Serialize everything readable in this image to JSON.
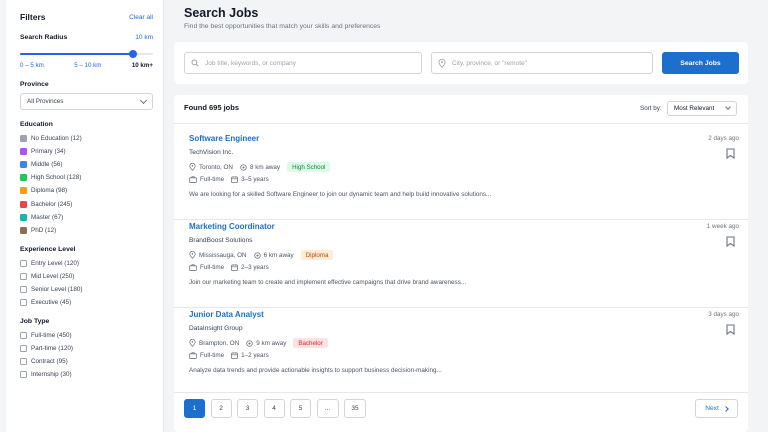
{
  "filters": {
    "title": "Filters",
    "clear_all": "Clear all",
    "radius": {
      "label": "Search Radius",
      "value_text": "10 km",
      "fraction": 0.85,
      "ticks": [
        "0 – 5 km",
        "5 – 10 km",
        "10 km+"
      ]
    },
    "province": {
      "label": "Province",
      "selected": "All Provinces"
    },
    "education": {
      "label": "Education",
      "items": [
        {
          "label": "No Education (12)",
          "color": "#9ca3af"
        },
        {
          "label": "Primary (34)",
          "color": "#a855f7"
        },
        {
          "label": "Middle (56)",
          "color": "#3b82f6"
        },
        {
          "label": "High School (128)",
          "color": "#22c55e"
        },
        {
          "label": "Diploma (98)",
          "color": "#f59e0b"
        },
        {
          "label": "Bachelor (245)",
          "color": "#ef4444"
        },
        {
          "label": "Master (67)",
          "color": "#14b8a6"
        },
        {
          "label": "PhD (12)",
          "color": "#8b6f5c"
        }
      ]
    },
    "experience": {
      "label": "Experience Level",
      "items": [
        "Entry Level (120)",
        "Mid Level (250)",
        "Senior Level (180)",
        "Executive (45)"
      ]
    },
    "job_type": {
      "label": "Job Type",
      "items": [
        "Full-time (450)",
        "Part-time (120)",
        "Contract (95)",
        "Internship (30)"
      ]
    }
  },
  "header": {
    "title": "Search Jobs",
    "subtitle": "Find the best opportunities that match your skills and preferences"
  },
  "search": {
    "keyword_placeholder": "Job title, keywords, or company",
    "location_placeholder": "City, province, or \"remote\"",
    "button": "Search Jobs"
  },
  "results": {
    "found": "Found 695 jobs",
    "sort_label": "Sort by:",
    "sort_value": "Most Relevant",
    "jobs": [
      {
        "title": "Software Engineer",
        "age": "2 days ago",
        "company": "TechVision Inc.",
        "location": "Toronto, ON",
        "distance": "8 km away",
        "education": "High School",
        "badge_bg": "#dcfce7",
        "badge_fg": "#15803d",
        "type": "Full-time",
        "experience": "3–5 years",
        "description": "We are looking for a skilled Software Engineer to join our dynamic team and help build innovative solutions..."
      },
      {
        "title": "Marketing Coordinator",
        "age": "1 week ago",
        "company": "BrandBoost Solutions",
        "location": "Mississauga, ON",
        "distance": "6 km away",
        "education": "Diploma",
        "badge_bg": "#ffedd5",
        "badge_fg": "#c2410c",
        "type": "Full-time",
        "experience": "2–3 years",
        "description": "Join our marketing team to create and implement effective campaigns that drive brand awareness..."
      },
      {
        "title": "Junior Data Analyst",
        "age": "3 days ago",
        "company": "DataInsight Group",
        "location": "Brampton, ON",
        "distance": "9 km away",
        "education": "Bachelor",
        "badge_bg": "#fee2e2",
        "badge_fg": "#dc2626",
        "type": "Full-time",
        "experience": "1–2 years",
        "description": "Analyze data trends and provide actionable insights to support business decision-making..."
      }
    ]
  },
  "pagination": {
    "pages": [
      "1",
      "2",
      "3",
      "4",
      "5",
      "...",
      "35"
    ],
    "current": "1",
    "next": "Next"
  }
}
